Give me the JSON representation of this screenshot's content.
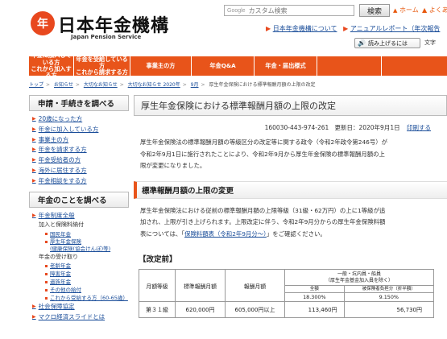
{
  "header": {
    "logo_mark": "年",
    "logo_text": "日本年金機構",
    "logo_sub": "Japan Pension Service",
    "search_engine": "Google",
    "search_placeholder": "カスタム検索",
    "search_button": "検索",
    "home_label": "ホーム",
    "home_arrow": "▲",
    "top_right_link": "よくあ",
    "subnav_arrow": "▶",
    "subnav_links": [
      "日本年金機構について",
      "アニュアルレポート（年次報告"
    ],
    "readaloud_label": "読み上げるには",
    "textsize_label": "文字"
  },
  "gnav": [
    "年金に加入している方\nこれから加入する方",
    "年金を受給している方\nこれから請求する方",
    "事業主の方",
    "年金Q&A",
    "年金・届出様式",
    "",
    ""
  ],
  "gnav_full": {
    "item1": "年金に加入している方\nこれから加入する方",
    "item2": "年金を受給している方\nこれから請求する方",
    "item3": "事業主の方",
    "item4": "年金Q&A",
    "item5": "年金・届出様式"
  },
  "breadcrumb": [
    "トップ",
    "お知らせ",
    "大切なお知らせ",
    "大切なお知らせ 2020年",
    "9月",
    "厚生年金保険における標準報酬月額の上限の改定"
  ],
  "sidebar": {
    "head1": "申請・手続きを調べる",
    "arrow": "▶",
    "items1": [
      "20歳になった方",
      "年金に加入している方",
      "事業主の方",
      "年金を請求する方",
      "年金受給者の方",
      "海外に居住する方",
      "年金相談をする方"
    ],
    "head2": "年金のことを調べる",
    "items2_top": "年金制度全般",
    "sub_join": "加入と保険料納付",
    "sub_join_items": [
      "国民年金",
      "厚生年金保険\n(健康保険(協会けんぽ)等)"
    ],
    "sub_receive": "年金の受け取り",
    "sub_receive_items": [
      "老齢年金",
      "障害年金",
      "遺族年金",
      "その他の給付",
      "これから受給する方（60-65歳）"
    ],
    "items2_bottom": [
      "社会保障協定",
      "マクロ経済スライドとは"
    ]
  },
  "main": {
    "title": "厚生年金保険における標準報酬月額の上限の改定",
    "doc_id": "160030-443-974-261",
    "updated_label": "更新日：2020年9月1日",
    "print_label": "印刷する",
    "para1_line1": "厚生年金保険法の標準報酬月額の等級区分の改定等に関する政令（令和2年政令第246号）が",
    "para1_line2": "令和2年9月1日に施行されたことにより、令和2年9月から厚生年金保険の標準報酬月額の上",
    "para1_line3": "限が変更になりました。",
    "section_title": "標準報酬月額の上限の変更",
    "para2_line1": "厚生年金保険法における従前の標準報酬月額の上限等級（31級・62万円）の上に1等級が追",
    "para2_line2": "加され、上限が引き上げられます。上限改定に伴う、令和2年9月分からの厚生年金保険料額",
    "para2_line3_pre": "表については、「",
    "para2_link": "保険料額表（令和2年9月分～）",
    "para2_line3_post": "」をご確認ください。",
    "table_caption": "【改定前】"
  },
  "table": {
    "col_grade": "月額等級",
    "col_standard": "標準報酬月額",
    "col_range": "報酬月額",
    "col_premium_line1": "一般・坑内員・船員",
    "col_premium_line2": "（厚生年金基金加入員を除く）",
    "sub_total": "全額",
    "sub_half": "被保険者負担分（折半額）",
    "rate_total": "18.300%",
    "rate_half": "9.150%",
    "row_grade": "第３１級",
    "row_standard": "620,000円",
    "row_range": "605,000円以上",
    "row_total": "113,460円",
    "row_half": "56,730円"
  },
  "colors": {
    "accent": "#e8541a",
    "link": "#1a4d99"
  }
}
